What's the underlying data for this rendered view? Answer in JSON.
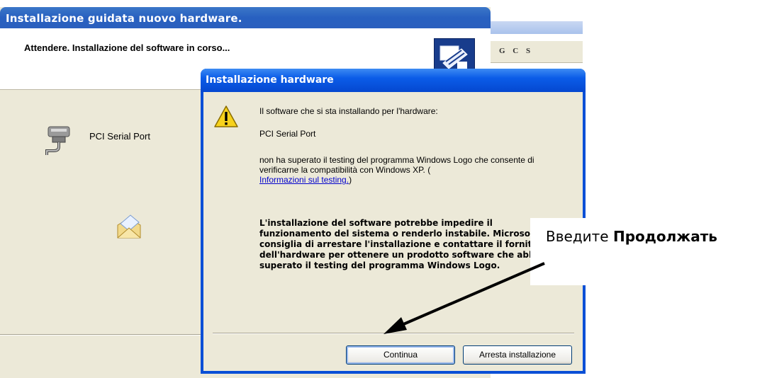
{
  "wizard": {
    "title": "Installazione guidata nuovo hardware.",
    "subtitle": "Attendere. Installazione del software in corso...",
    "device_name": "PCI Serial Port"
  },
  "editor": {
    "toolbar_buttons": "G C S"
  },
  "dialog": {
    "title": "Installazione hardware",
    "intro": "Il software che si sta installando per l'hardware:",
    "device_name": "PCI Serial Port",
    "not_logo_text": "non ha superato il testing del programma Windows Logo che consente di verificarne la compatibilità con Windows XP. (",
    "link_text": "Informazioni sul testing.",
    "link_close": ")",
    "warning": "L'installazione del software potrebbe impedire il funzionamento del sistema o renderlo instabile. Microsoft consiglia di arrestare l'installazione e contattare il fornitore dell'hardware per ottenere un prodotto software che abbia superato il testing del programma Windows Logo.",
    "continue_label": "Continua",
    "stop_label": "Arresta installazione"
  },
  "annotation": {
    "prefix": "Введите ",
    "bold": "Продолжать"
  },
  "colors": {
    "title_blue": "#0b5ce8",
    "face": "#ece9d8",
    "link": "#0000cc"
  }
}
